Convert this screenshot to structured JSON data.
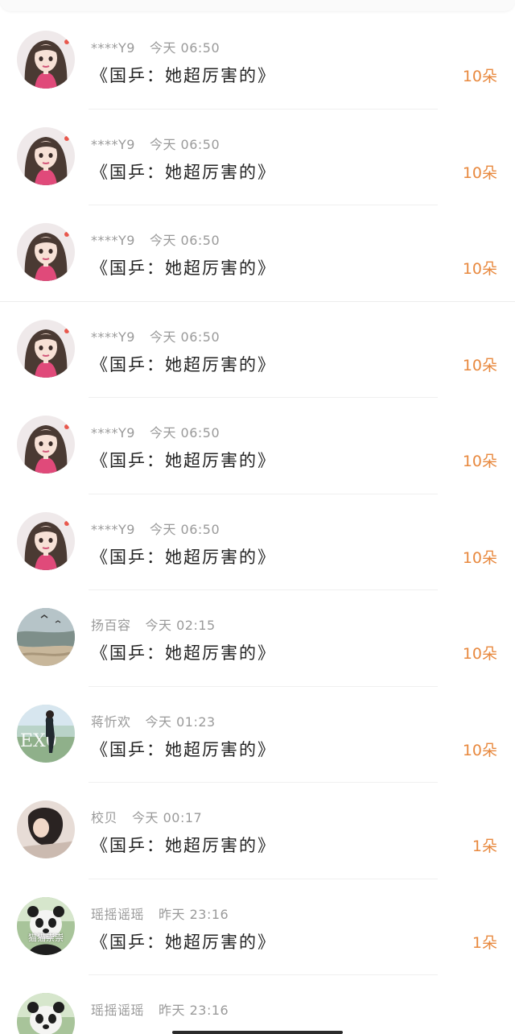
{
  "comments": [
    {
      "avatar": "girl-avatar",
      "name": "****Y9",
      "time": "今天 06:50",
      "title": "《国乒：她超厉害的》",
      "gift": "10朵"
    },
    {
      "avatar": "girl-avatar",
      "name": "****Y9",
      "time": "今天 06:50",
      "title": "《国乒：她超厉害的》",
      "gift": "10朵"
    },
    {
      "avatar": "girl-avatar",
      "name": "****Y9",
      "time": "今天 06:50",
      "title": "《国乒：她超厉害的》",
      "gift": "10朵"
    },
    {
      "avatar": "girl-avatar",
      "name": "****Y9",
      "time": "今天 06:50",
      "title": "《国乒：她超厉害的》",
      "gift": "10朵"
    },
    {
      "avatar": "girl-avatar",
      "name": "****Y9",
      "time": "今天 06:50",
      "title": "《国乒：她超厉害的》",
      "gift": "10朵"
    },
    {
      "avatar": "girl-avatar",
      "name": "****Y9",
      "time": "今天 06:50",
      "title": "《国乒：她超厉害的》",
      "gift": "10朵"
    },
    {
      "avatar": "beach-avatar",
      "name": "扬百容",
      "time": "今天 02:15",
      "title": "《国乒：她超厉害的》",
      "gift": "10朵"
    },
    {
      "avatar": "exo-avatar",
      "name": "蒋忻欢",
      "time": "今天 01:23",
      "title": "《国乒：她超厉害的》",
      "gift": "10朵"
    },
    {
      "avatar": "photo-avatar",
      "name": "校贝",
      "time": "今天 00:17",
      "title": "《国乒：她超厉害的》",
      "gift": "1朵"
    },
    {
      "avatar": "panda-avatar",
      "avatar_text": "猫猫崇崇",
      "name": "瑶摇谣瑶",
      "time": "昨天 23:16",
      "title": "《国乒：她超厉害的》",
      "gift": "1朵"
    },
    {
      "avatar": "panda-avatar",
      "name": "瑶摇谣瑶",
      "time": "昨天 23:16",
      "title": "",
      "gift": ""
    }
  ],
  "colors": {
    "gift": "#e8893f",
    "meta": "#9a9a9a",
    "title": "#222222"
  }
}
